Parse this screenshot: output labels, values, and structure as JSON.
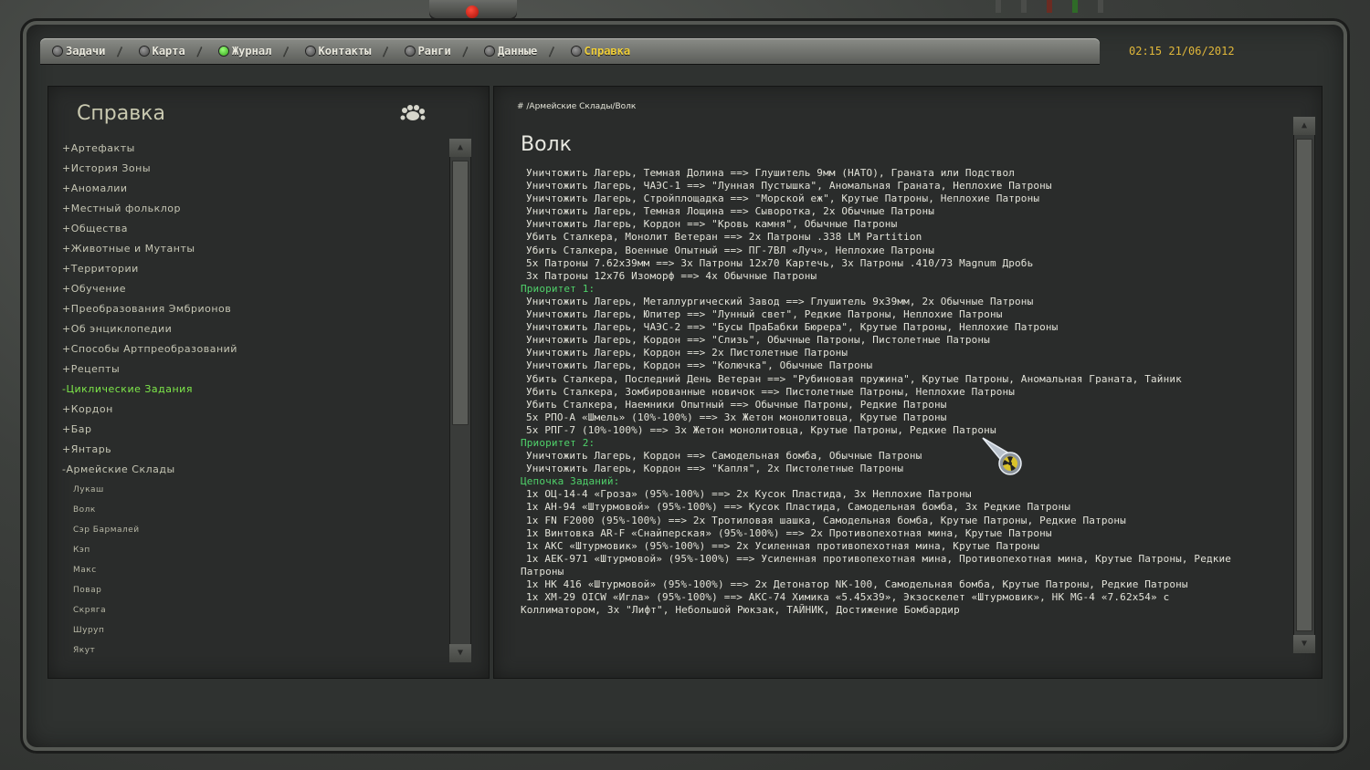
{
  "nav": {
    "tabs": [
      {
        "label": "Задачи",
        "state": "off"
      },
      {
        "label": "Карта",
        "state": "off"
      },
      {
        "label": "Журнал",
        "state": "on"
      },
      {
        "label": "Контакты",
        "state": "off"
      },
      {
        "label": "Ранги",
        "state": "off"
      },
      {
        "label": "Данные",
        "state": "off"
      },
      {
        "label": "Справка",
        "state": "active"
      }
    ],
    "datetime": "02:15  21/06/2012"
  },
  "sidebar": {
    "title": "Справка",
    "items": [
      {
        "label": "+Артефакты",
        "level": 1
      },
      {
        "label": "+История Зоны",
        "level": 1
      },
      {
        "label": "+Аномалии",
        "level": 1
      },
      {
        "label": "+Местный фольклор",
        "level": 1
      },
      {
        "label": "+Общества",
        "level": 1
      },
      {
        "label": "+Животные и Мутанты",
        "level": 1
      },
      {
        "label": "+Территории",
        "level": 1
      },
      {
        "label": "+Обучение",
        "level": 1
      },
      {
        "label": "+Преобразования Эмбрионов",
        "level": 1
      },
      {
        "label": "+Об энциклопедии",
        "level": 1
      },
      {
        "label": "+Способы Артпреобразований",
        "level": 1
      },
      {
        "label": "+Рецепты",
        "level": 1
      },
      {
        "label": "-Циклические Задания",
        "level": 1,
        "selected": true
      },
      {
        "label": "+Кордон",
        "level": 2
      },
      {
        "label": "+Бар",
        "level": 2
      },
      {
        "label": "+Янтарь",
        "level": 2
      },
      {
        "label": "-Армейские Склады",
        "level": 2
      },
      {
        "label": "Лукаш",
        "level": 3
      },
      {
        "label": "Волк",
        "level": 3
      },
      {
        "label": "Сэр Бармалей",
        "level": 3
      },
      {
        "label": "Кэп",
        "level": 3
      },
      {
        "label": "Макс",
        "level": 3
      },
      {
        "label": "Повар",
        "level": 3
      },
      {
        "label": "Скряга",
        "level": 3
      },
      {
        "label": "Шуруп",
        "level": 3
      },
      {
        "label": "Якут",
        "level": 3
      }
    ]
  },
  "article": {
    "breadcrumb": "#  /Армейские Склады/Волк",
    "title": "Волк",
    "lines": [
      {
        "text": "Уничтожить Лагерь, Темная Долина ==> Глушитель 9мм (НАТО), Граната или Подствол",
        "kind": "ind"
      },
      {
        "text": "Уничтожить Лагерь, ЧАЭС-1 ==> \"Лунная Пустышка\", Аномальная Граната, Неплохие Патроны",
        "kind": "ind"
      },
      {
        "text": "Уничтожить Лагерь, Стройплощадка ==> \"Морской еж\", Крутые Патроны, Неплохие Патроны",
        "kind": "ind"
      },
      {
        "text": "Уничтожить Лагерь, Темная Лощина ==> Сыворотка, 2x Обычные Патроны",
        "kind": "ind"
      },
      {
        "text": "Уничтожить Лагерь, Кордон ==> \"Кровь камня\", Обычные Патроны",
        "kind": "ind"
      },
      {
        "text": "Убить Сталкера, Монолит Ветеран ==> 2x Патроны .338 LM Partition",
        "kind": "ind"
      },
      {
        "text": "Убить Сталкера, Военные Опытный ==> ПГ-7ВЛ «Луч», Неплохие Патроны",
        "kind": "ind"
      },
      {
        "text": "5x Патроны 7.62x39мм ==> 3x Патроны 12x70 Картечь, 3x Патроны .410/73 Magnum Дробь",
        "kind": "ind"
      },
      {
        "text": "3x Патроны 12x76 Изоморф ==> 4x Обычные Патроны",
        "kind": "ind"
      },
      {
        "text": "Приоритет 1:",
        "kind": "head"
      },
      {
        "text": "Уничтожить Лагерь, Металлургический Завод ==> Глушитель 9x39мм, 2x Обычные Патроны",
        "kind": "ind"
      },
      {
        "text": "Уничтожить Лагерь, Юпитер ==> \"Лунный свет\", Редкие Патроны, Неплохие Патроны",
        "kind": "ind"
      },
      {
        "text": "Уничтожить Лагерь, ЧАЭС-2 ==> \"Бусы ПраБабки Бюрера\", Крутые Патроны, Неплохие Патроны",
        "kind": "ind"
      },
      {
        "text": "Уничтожить Лагерь, Кордон ==> \"Слизь\", Обычные Патроны, Пистолетные Патроны",
        "kind": "ind"
      },
      {
        "text": "Уничтожить Лагерь, Кордон ==> 2x Пистолетные Патроны",
        "kind": "ind"
      },
      {
        "text": "Уничтожить Лагерь, Кордон ==> \"Колючка\", Обычные Патроны",
        "kind": "ind"
      },
      {
        "text": "Убить Сталкера, Последний День Ветеран ==> \"Рубиновая пружина\", Крутые Патроны, Аномальная Граната, Тайник",
        "kind": "ind"
      },
      {
        "text": "Убить Сталкера, Зомбированные новичок ==> Пистолетные Патроны, Неплохие Патроны",
        "kind": "ind"
      },
      {
        "text": "Убить Сталкера, Наемники Опытный ==> Обычные Патроны, Редкие Патроны",
        "kind": "ind"
      },
      {
        "text": "5x РПО-А «Шмель» (10%-100%) ==> 3x Жетон монолитовца, Крутые Патроны",
        "kind": "ind"
      },
      {
        "text": "5x РПГ-7 (10%-100%) ==> 3x Жетон монолитовца, Крутые Патроны, Редкие Патроны",
        "kind": "ind"
      },
      {
        "text": "Приоритет 2:",
        "kind": "head"
      },
      {
        "text": "Уничтожить Лагерь, Кордон ==> Самодельная бомба, Обычные Патроны",
        "kind": "ind"
      },
      {
        "text": "Уничтожить Лагерь, Кордон ==> \"Капля\", 2x Пистолетные Патроны",
        "kind": "ind"
      },
      {
        "text": "Цепочка Заданий:",
        "kind": "head"
      },
      {
        "text": "1x ОЦ-14-4 «Гроза» (95%-100%) ==> 2x Кусок Пластида, 3x Неплохие Патроны",
        "kind": "ind"
      },
      {
        "text": "1x АН-94 «Штурмовой» (95%-100%) ==> Кусок Пластида, Самодельная бомба, 3x Редкие Патроны",
        "kind": "ind"
      },
      {
        "text": "1x FN F2000 (95%-100%) ==> 2x Тротиловая шашка, Самодельная бомба, Крутые Патроны, Редкие Патроны",
        "kind": "ind"
      },
      {
        "text": "1x Винтовка AR-F «Снайперская» (95%-100%) ==> 2x Противопехотная мина, Крутые Патроны",
        "kind": "ind"
      },
      {
        "text": "1x АКС «Штурмовик» (95%-100%) ==> 2x Усиленная противопехотная мина, Крутые Патроны",
        "kind": "ind"
      },
      {
        "text": "1x АЕК-971 «Штурмовой» (95%-100%) ==> Усиленная противопехотная мина, Противопехотная мина, Крутые Патроны, Редкие",
        "kind": "ind"
      },
      {
        "text": "Патроны",
        "kind": "plain"
      },
      {
        "text": "1x HK 416 «Штурмовой» (95%-100%) ==> 2x Детонатор NK-100, Самодельная бомба, Крутые Патроны, Редкие Патроны",
        "kind": "ind"
      },
      {
        "text": "1x XM-29 OICW «Игла» (95%-100%) ==> АКС-74 Химика «5.45x39», Экзоскелет «Штурмовик», НК MG-4 «7.62x54» с",
        "kind": "ind"
      },
      {
        "text": "Коллиматором, 3x \"Лифт\", Небольшой Рюкзак, ТАЙНИК, Достижение Бомбардир",
        "kind": "plain"
      }
    ]
  },
  "icons": {
    "sidebar_header": "paw-icon",
    "cursor": "radiation-cursor-icon"
  },
  "colors": {
    "active_tab": "#f0cf3a",
    "selected_item": "#7ee84a",
    "section_heading": "#4fd16a",
    "datetime": "#e0b73a"
  }
}
